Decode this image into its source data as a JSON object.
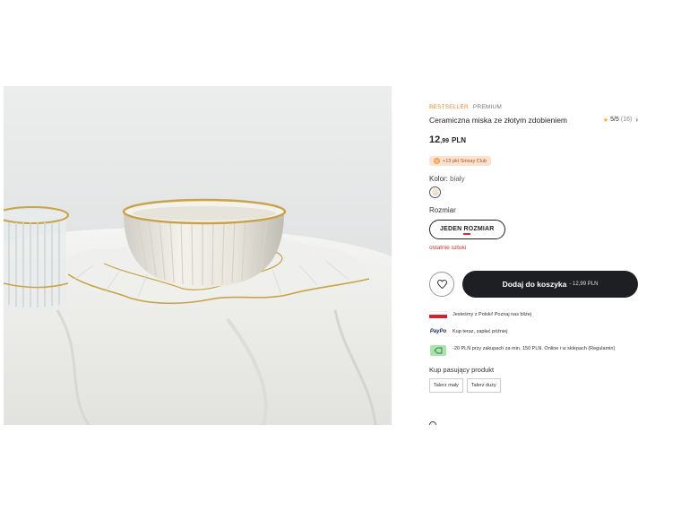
{
  "product": {
    "tags": [
      "BESTSELLER",
      "PREMIUM"
    ],
    "title": "Ceramiczna miska ze złotym zdobieniem",
    "rating": {
      "value": "5/5",
      "count": "(16)"
    },
    "price": {
      "main": "12",
      "decimal": ",99",
      "currency": "PLN"
    },
    "club_badge": "+13 pkt Sinsay Club",
    "color_label": "Kolor: ",
    "color_value": "biały",
    "size_label": "Rozmiar",
    "size_option": "JEDEN ROZMIAR",
    "stock_note": "ostatnie sztuki"
  },
  "cart": {
    "label": "Dodaj do koszyka",
    "price_suffix": " - 12,99 PLN"
  },
  "perks": [
    {
      "icon": "poland-flag-icon",
      "text": "Jesteśmy z Polski! Poznaj nas bliżej"
    },
    {
      "icon": "paypo-icon",
      "icon_text": "PayPo",
      "text": "Kup teraz, zapłać później"
    },
    {
      "icon": "coupon-icon",
      "text": "-20 PLN przy zakupach za min. 150 PLN. Online i w sklepach (Regulamin)"
    }
  ],
  "matching": {
    "label": "Kup pasujący produkt",
    "items": [
      "Talerz mały",
      "Talerz duży"
    ]
  },
  "colors": {
    "accent": "#e58b2b",
    "button": "#1e1f22",
    "warning": "#d0312d",
    "star": "#f2b01e"
  }
}
